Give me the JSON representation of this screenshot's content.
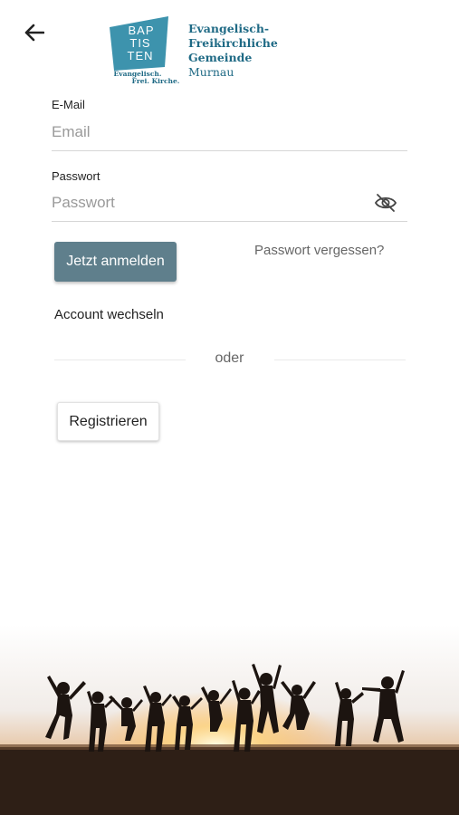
{
  "header": {
    "back_icon": "arrow-left-icon",
    "logo": {
      "badge_line1": "BAP",
      "badge_line2": "TIS",
      "badge_line3": "TEN",
      "tagline_line1": "Evangelisch.",
      "tagline_line2": "Frei. Kirche.",
      "title_line1": "Evangelisch-",
      "title_line2": "Freikirchliche Gemeinde",
      "title_line3": "Murnau",
      "brand_color": "#1f6a85",
      "badge_color": "#3d93ad"
    }
  },
  "form": {
    "email_label": "E-Mail",
    "email_placeholder": "Email",
    "email_value": "",
    "password_label": "Passwort",
    "password_placeholder": "Passwort",
    "password_value": "",
    "password_visibility_icon": "eye-off-icon",
    "login_label": "Jetzt anmelden",
    "forgot_label": "Passwort vergessen?",
    "switch_account_label": "Account wechseln",
    "divider_label": "oder",
    "register_label": "Registrieren"
  },
  "colors": {
    "primary_button": "#5f7f8c",
    "text_secondary": "#666666"
  }
}
